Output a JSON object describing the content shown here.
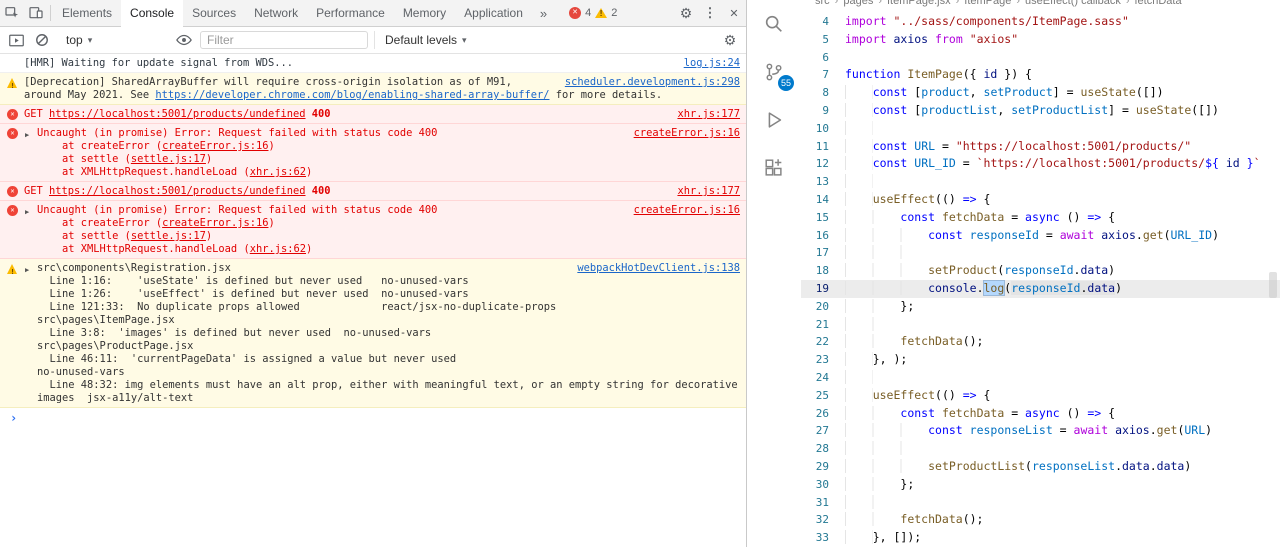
{
  "devtools": {
    "tabs": [
      "Elements",
      "Console",
      "Sources",
      "Network",
      "Performance",
      "Memory",
      "Application"
    ],
    "active_tab": "Console",
    "more_tabs_glyph": "»",
    "badges": {
      "errors": "4",
      "warnings": "2"
    },
    "toolbar": {
      "context": "top",
      "filter_placeholder": "Filter",
      "levels_label": "Default levels",
      "icons": [
        "console-sidebar-icon",
        "clear-console-icon",
        "live-expression-eye-icon",
        "console-settings-gear-icon"
      ]
    },
    "top_icons": [
      "inspect-element-icon",
      "device-toolbar-icon",
      "settings-gear-icon",
      "kebab-menu-icon",
      "close-icon"
    ],
    "prompt_chevron": "›",
    "messages": [
      {
        "type": "log",
        "icon": null,
        "expander": false,
        "source": "log.js:24",
        "lines": [
          [
            [
              "t",
              "[HMR] Waiting for update signal from WDS..."
            ]
          ]
        ]
      },
      {
        "type": "warn",
        "icon": "warn",
        "expander": false,
        "source": "scheduler.development.js:298",
        "lines": [
          [
            [
              "t",
              "[Deprecation] SharedArrayBuffer will require cross-origin isolation as of M91,"
            ]
          ],
          [
            [
              "t",
              "around May 2021. See "
            ],
            [
              "link",
              "https://developer.chrome.com/blog/enabling-shared-array-buffer/"
            ],
            [
              "t",
              " for more details."
            ]
          ]
        ]
      },
      {
        "type": "error",
        "icon": "error",
        "expander": false,
        "source": "xhr.js:177",
        "lines": [
          [
            [
              "t",
              "GET "
            ],
            [
              "elink",
              "https://localhost:5001/products/undefined"
            ],
            [
              "b",
              " 400"
            ]
          ]
        ]
      },
      {
        "type": "error",
        "icon": "error",
        "expander": true,
        "source": "createError.js:16",
        "lines": [
          [
            [
              "t",
              "Uncaught (in promise) Error: Request failed with status code 400"
            ]
          ],
          [
            [
              "t",
              "    at createError ("
            ],
            [
              "elink",
              "createError.js:16"
            ],
            [
              "t",
              ")"
            ]
          ],
          [
            [
              "t",
              "    at settle ("
            ],
            [
              "elink",
              "settle.js:17"
            ],
            [
              "t",
              ")"
            ]
          ],
          [
            [
              "t",
              "    at XMLHttpRequest.handleLoad ("
            ],
            [
              "elink",
              "xhr.js:62"
            ],
            [
              "t",
              ")"
            ]
          ]
        ]
      },
      {
        "type": "error",
        "icon": "error",
        "expander": false,
        "source": "xhr.js:177",
        "lines": [
          [
            [
              "t",
              "GET "
            ],
            [
              "elink",
              "https://localhost:5001/products/undefined"
            ],
            [
              "b",
              " 400"
            ]
          ]
        ]
      },
      {
        "type": "error",
        "icon": "error",
        "expander": true,
        "source": "createError.js:16",
        "lines": [
          [
            [
              "t",
              "Uncaught (in promise) Error: Request failed with status code 400"
            ]
          ],
          [
            [
              "t",
              "    at createError ("
            ],
            [
              "elink",
              "createError.js:16"
            ],
            [
              "t",
              ")"
            ]
          ],
          [
            [
              "t",
              "    at settle ("
            ],
            [
              "elink",
              "settle.js:17"
            ],
            [
              "t",
              ")"
            ]
          ],
          [
            [
              "t",
              "    at XMLHttpRequest.handleLoad ("
            ],
            [
              "elink",
              "xhr.js:62"
            ],
            [
              "t",
              ")"
            ]
          ]
        ]
      },
      {
        "type": "warn",
        "icon": "warn",
        "expander": true,
        "source": "webpackHotDevClient.js:138",
        "lines": [
          [
            [
              "t",
              "src\\components\\Registration.jsx"
            ]
          ],
          [
            [
              "t",
              "  Line 1:16:    'useState' is defined but never used   no-unused-vars"
            ]
          ],
          [
            [
              "t",
              "  Line 1:26:    'useEffect' is defined but never used  no-unused-vars"
            ]
          ],
          [
            [
              "t",
              "  Line 121:33:  No duplicate props allowed             react/jsx-no-duplicate-props"
            ]
          ],
          [
            [
              "t",
              ""
            ]
          ],
          [
            [
              "t",
              "src\\pages\\ItemPage.jsx"
            ]
          ],
          [
            [
              "t",
              "  Line 3:8:  'images' is defined but never used  no-unused-vars"
            ]
          ],
          [
            [
              "t",
              ""
            ]
          ],
          [
            [
              "t",
              "src\\pages\\ProductPage.jsx"
            ]
          ],
          [
            [
              "t",
              "  Line 46:11:  'currentPageData' is assigned a value but never used"
            ]
          ],
          [
            [
              "t",
              "no-unused-vars"
            ]
          ],
          [
            [
              "t",
              "  Line 48:32: img elements must have an alt prop, either with meaningful text, or an empty string for decorative"
            ]
          ],
          [
            [
              "t",
              "images  jsx-a11y/alt-text"
            ]
          ]
        ]
      }
    ]
  },
  "editor": {
    "breadcrumb": [
      "src",
      "pages",
      "ItemPage.jsx",
      "ItemPage",
      "useEffect() callback",
      "fetchData"
    ],
    "activity_icons": [
      "search",
      "source-control",
      "run-and-debug",
      "extensions"
    ],
    "activity_badge": "55",
    "current_line": 19,
    "lines": [
      {
        "n": 4,
        "t": [
          [
            "kw2",
            "import"
          ],
          [
            "pl",
            " "
          ],
          [
            "str",
            "\"../sass/components/ItemPage.sass\""
          ]
        ]
      },
      {
        "n": 5,
        "t": [
          [
            "kw2",
            "import"
          ],
          [
            "pl",
            " "
          ],
          [
            "v",
            "axios"
          ],
          [
            "pl",
            " "
          ],
          [
            "kw2",
            "from"
          ],
          [
            "pl",
            " "
          ],
          [
            "str",
            "\"axios\""
          ]
        ]
      },
      {
        "n": 6,
        "t": [
          [
            "pl",
            ""
          ]
        ]
      },
      {
        "n": 7,
        "t": [
          [
            "kw1",
            "function"
          ],
          [
            "pl",
            " "
          ],
          [
            "fn",
            "ItemPage"
          ],
          [
            "pl",
            "({ "
          ],
          [
            "v",
            "id"
          ],
          [
            "pl",
            " }) {"
          ]
        ]
      },
      {
        "n": 8,
        "t": [
          [
            "ind",
            "    "
          ],
          [
            "kw1",
            "const"
          ],
          [
            "pl",
            " ["
          ],
          [
            "cv",
            "product"
          ],
          [
            "pl",
            ", "
          ],
          [
            "cv",
            "setProduct"
          ],
          [
            "pl",
            "] = "
          ],
          [
            "fn",
            "useState"
          ],
          [
            "pl",
            "([])"
          ]
        ]
      },
      {
        "n": 9,
        "t": [
          [
            "ind",
            "    "
          ],
          [
            "kw1",
            "const"
          ],
          [
            "pl",
            " ["
          ],
          [
            "cv",
            "productList"
          ],
          [
            "pl",
            ", "
          ],
          [
            "cv",
            "setProductList"
          ],
          [
            "pl",
            "] = "
          ],
          [
            "fn",
            "useState"
          ],
          [
            "pl",
            "([])"
          ]
        ]
      },
      {
        "n": 10,
        "t": [
          [
            "ind",
            "    "
          ]
        ]
      },
      {
        "n": 11,
        "t": [
          [
            "ind",
            "    "
          ],
          [
            "kw1",
            "const"
          ],
          [
            "pl",
            " "
          ],
          [
            "cv",
            "URL"
          ],
          [
            "pl",
            " = "
          ],
          [
            "str",
            "\"https://localhost:5001/products/\""
          ]
        ]
      },
      {
        "n": 12,
        "t": [
          [
            "ind",
            "    "
          ],
          [
            "kw1",
            "const"
          ],
          [
            "pl",
            " "
          ],
          [
            "cv",
            "URL_ID"
          ],
          [
            "pl",
            " = "
          ],
          [
            "str",
            "`https://localhost:5001/products/"
          ],
          [
            "kw1",
            "${"
          ],
          [
            "pl",
            " "
          ],
          [
            "v",
            "id"
          ],
          [
            "pl",
            " "
          ],
          [
            "kw1",
            "}"
          ],
          [
            "str",
            "`"
          ]
        ]
      },
      {
        "n": 13,
        "t": [
          [
            "ind",
            "    "
          ]
        ]
      },
      {
        "n": 14,
        "t": [
          [
            "ind",
            "    "
          ],
          [
            "fn",
            "useEffect"
          ],
          [
            "pl",
            "(() "
          ],
          [
            "kw1",
            "=>"
          ],
          [
            "pl",
            " {"
          ]
        ]
      },
      {
        "n": 15,
        "t": [
          [
            "ind",
            "        "
          ],
          [
            "kw1",
            "const"
          ],
          [
            "pl",
            " "
          ],
          [
            "fn",
            "fetchData"
          ],
          [
            "pl",
            " = "
          ],
          [
            "kw1",
            "async"
          ],
          [
            "pl",
            " () "
          ],
          [
            "kw1",
            "=>"
          ],
          [
            "pl",
            " {"
          ]
        ]
      },
      {
        "n": 16,
        "t": [
          [
            "ind",
            "            "
          ],
          [
            "kw1",
            "const"
          ],
          [
            "pl",
            " "
          ],
          [
            "cv",
            "responseId"
          ],
          [
            "pl",
            " = "
          ],
          [
            "kw2",
            "await"
          ],
          [
            "pl",
            " "
          ],
          [
            "v",
            "axios"
          ],
          [
            "pl",
            "."
          ],
          [
            "fn",
            "get"
          ],
          [
            "pl",
            "("
          ],
          [
            "cv",
            "URL_ID"
          ],
          [
            "pl",
            ")"
          ]
        ]
      },
      {
        "n": 17,
        "t": [
          [
            "ind",
            "            "
          ]
        ]
      },
      {
        "n": 18,
        "t": [
          [
            "ind",
            "            "
          ],
          [
            "fn",
            "setProduct"
          ],
          [
            "pl",
            "("
          ],
          [
            "cv",
            "responseId"
          ],
          [
            "pl",
            "."
          ],
          [
            "v",
            "data"
          ],
          [
            "pl",
            ")"
          ]
        ]
      },
      {
        "n": 19,
        "t": [
          [
            "ind",
            "            "
          ],
          [
            "v",
            "console"
          ],
          [
            "pl",
            "."
          ],
          [
            "fn sel",
            "log"
          ],
          [
            "pl",
            "("
          ],
          [
            "cv occ",
            "responseId"
          ],
          [
            "pl occ",
            "."
          ],
          [
            "v occ",
            "data"
          ],
          [
            "pl",
            ")"
          ]
        ]
      },
      {
        "n": 20,
        "t": [
          [
            "ind",
            "        "
          ],
          [
            "pl",
            "};"
          ]
        ]
      },
      {
        "n": 21,
        "t": [
          [
            "ind",
            "        "
          ]
        ]
      },
      {
        "n": 22,
        "t": [
          [
            "ind",
            "        "
          ],
          [
            "fn",
            "fetchData"
          ],
          [
            "pl",
            "();"
          ]
        ]
      },
      {
        "n": 23,
        "t": [
          [
            "ind",
            "    "
          ],
          [
            "pl",
            "}, );"
          ]
        ]
      },
      {
        "n": 24,
        "t": [
          [
            "ind",
            "    "
          ]
        ]
      },
      {
        "n": 25,
        "t": [
          [
            "ind",
            "    "
          ],
          [
            "fn",
            "useEffect"
          ],
          [
            "pl",
            "(() "
          ],
          [
            "kw1",
            "=>"
          ],
          [
            "pl",
            " {"
          ]
        ]
      },
      {
        "n": 26,
        "t": [
          [
            "ind",
            "        "
          ],
          [
            "kw1",
            "const"
          ],
          [
            "pl",
            " "
          ],
          [
            "fn",
            "fetchData"
          ],
          [
            "pl",
            " = "
          ],
          [
            "kw1",
            "async"
          ],
          [
            "pl",
            " () "
          ],
          [
            "kw1",
            "=>"
          ],
          [
            "pl",
            " {"
          ]
        ]
      },
      {
        "n": 27,
        "t": [
          [
            "ind",
            "            "
          ],
          [
            "kw1",
            "const"
          ],
          [
            "pl",
            " "
          ],
          [
            "cv",
            "responseList"
          ],
          [
            "pl",
            " = "
          ],
          [
            "kw2",
            "await"
          ],
          [
            "pl",
            " "
          ],
          [
            "v",
            "axios"
          ],
          [
            "pl",
            "."
          ],
          [
            "fn",
            "get"
          ],
          [
            "pl",
            "("
          ],
          [
            "cv",
            "URL"
          ],
          [
            "pl",
            ")"
          ]
        ]
      },
      {
        "n": 28,
        "t": [
          [
            "ind",
            "            "
          ]
        ]
      },
      {
        "n": 29,
        "t": [
          [
            "ind",
            "            "
          ],
          [
            "fn",
            "setProductList"
          ],
          [
            "pl",
            "("
          ],
          [
            "cv",
            "responseList"
          ],
          [
            "pl",
            "."
          ],
          [
            "v",
            "data"
          ],
          [
            "pl",
            "."
          ],
          [
            "v",
            "data"
          ],
          [
            "pl",
            ")"
          ]
        ]
      },
      {
        "n": 30,
        "t": [
          [
            "ind",
            "        "
          ],
          [
            "pl",
            "};"
          ]
        ]
      },
      {
        "n": 31,
        "t": [
          [
            "ind",
            "        "
          ]
        ]
      },
      {
        "n": 32,
        "t": [
          [
            "ind",
            "        "
          ],
          [
            "fn",
            "fetchData"
          ],
          [
            "pl",
            "();"
          ]
        ]
      },
      {
        "n": 33,
        "t": [
          [
            "ind",
            "    "
          ],
          [
            "pl",
            "}, []);"
          ]
        ]
      }
    ]
  },
  "colors": {
    "error_bg": "#fff0f0",
    "error_text": "#e20000",
    "warning_bg": "#fffbe5",
    "link_blue": "#1b66c9",
    "badge_blue": "#007acc",
    "keyword_blue": "#0000ff",
    "keyword_purple": "#af00db",
    "function_brown": "#795e26",
    "variable_blue": "#001080",
    "const_blue": "#0070c1",
    "string_red": "#a31515"
  }
}
